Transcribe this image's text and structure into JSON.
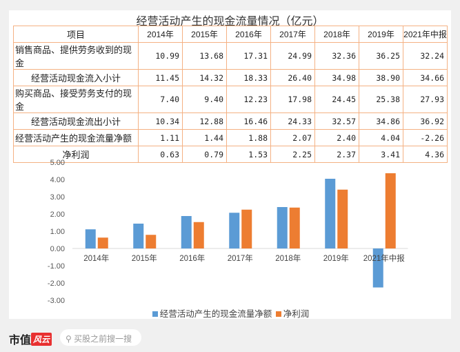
{
  "title": "经营活动产生的现金流量情况（亿元）",
  "table": {
    "headers": [
      "项目",
      "2014年",
      "2015年",
      "2016年",
      "2017年",
      "2018年",
      "2019年",
      "2021年中报"
    ],
    "rows": [
      {
        "label": "销售商品、提供劳务收到的现金",
        "values": [
          "10.99",
          "13.68",
          "17.31",
          "24.99",
          "32.36",
          "36.25",
          "32.24"
        ]
      },
      {
        "label": "经营活动现金流入小计",
        "values": [
          "11.45",
          "14.32",
          "18.33",
          "26.40",
          "34.98",
          "38.90",
          "34.66"
        ]
      },
      {
        "label": "购买商品、接受劳务支付的现金",
        "values": [
          "7.40",
          "9.40",
          "12.23",
          "17.98",
          "24.45",
          "25.38",
          "27.93"
        ]
      },
      {
        "label": "经营活动现金流出小计",
        "values": [
          "10.34",
          "12.88",
          "16.46",
          "24.33",
          "32.57",
          "34.86",
          "36.92"
        ]
      },
      {
        "label": "经营活动产生的现金流量净额",
        "values": [
          "1.11",
          "1.44",
          "1.88",
          "2.07",
          "2.40",
          "4.04",
          "-2.26"
        ]
      },
      {
        "label": "净利润",
        "values": [
          "0.63",
          "0.79",
          "1.53",
          "2.25",
          "2.37",
          "3.41",
          "4.36"
        ]
      }
    ]
  },
  "chart_data": {
    "type": "bar",
    "categories": [
      "2014年",
      "2015年",
      "2016年",
      "2017年",
      "2018年",
      "2019年",
      "2021年中报"
    ],
    "series": [
      {
        "name": "经营活动产生的现金流量净额",
        "color": "#5b9bd5",
        "values": [
          1.11,
          1.44,
          1.88,
          2.07,
          2.4,
          4.04,
          -2.26
        ]
      },
      {
        "name": "净利润",
        "color": "#ed7d31",
        "values": [
          0.63,
          0.79,
          1.53,
          2.25,
          2.37,
          3.41,
          4.36
        ]
      }
    ],
    "yticks": [
      "5.00",
      "4.00",
      "3.00",
      "2.00",
      "1.00",
      "0.00",
      "-1.00",
      "-2.00",
      "-3.00"
    ],
    "ylim": [
      -3,
      5
    ],
    "legend": "bottom"
  },
  "footer": {
    "brand": "市值",
    "logo": "风云",
    "search_placeholder": "买股之前搜一搜"
  }
}
